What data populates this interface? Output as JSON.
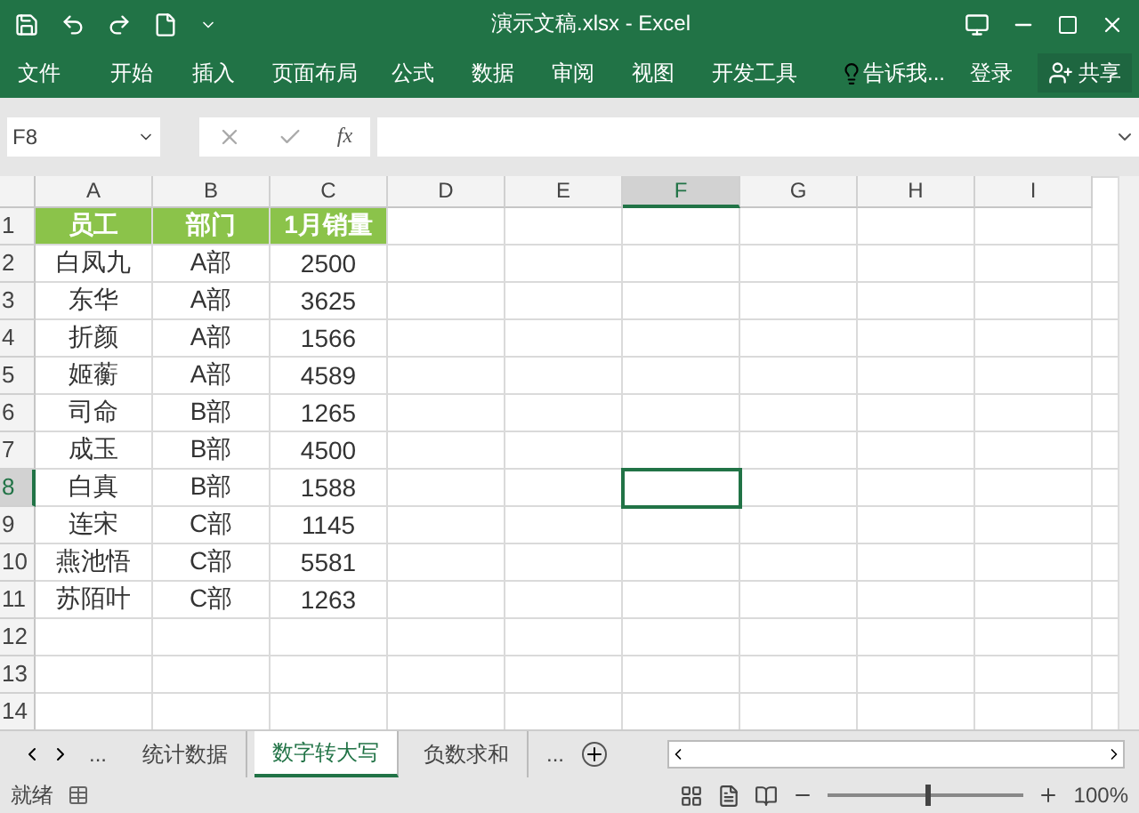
{
  "window": {
    "title": "演示文稿.xlsx - Excel"
  },
  "ribbon_tabs": [
    "文件",
    "开始",
    "插入",
    "页面布局",
    "公式",
    "数据",
    "审阅",
    "视图",
    "开发工具"
  ],
  "tell_me": "告诉我...",
  "sign_in": "登录",
  "share": "共享",
  "formula_bar": {
    "name_box": "F8",
    "fx": "fx"
  },
  "columns": [
    {
      "label": "A",
      "selected": false
    },
    {
      "label": "B",
      "selected": false
    },
    {
      "label": "C",
      "selected": false
    },
    {
      "label": "D",
      "selected": false
    },
    {
      "label": "E",
      "selected": false
    },
    {
      "label": "F",
      "selected": true
    },
    {
      "label": "G",
      "selected": false
    },
    {
      "label": "H",
      "selected": false
    },
    {
      "label": "I",
      "selected": false
    }
  ],
  "rows": [
    {
      "number": "1",
      "selected": false,
      "kind": "header",
      "cells": [
        "员工",
        "部门",
        "1月销量"
      ]
    },
    {
      "number": "2",
      "selected": false,
      "kind": "data",
      "cells": [
        "白凤九",
        "A部",
        "2500"
      ]
    },
    {
      "number": "3",
      "selected": false,
      "kind": "data",
      "cells": [
        "东华",
        "A部",
        "3625"
      ]
    },
    {
      "number": "4",
      "selected": false,
      "kind": "data",
      "cells": [
        "折颜",
        "A部",
        "1566"
      ]
    },
    {
      "number": "5",
      "selected": false,
      "kind": "data",
      "cells": [
        "姬蘅",
        "A部",
        "4589"
      ]
    },
    {
      "number": "6",
      "selected": false,
      "kind": "data",
      "cells": [
        "司命",
        "B部",
        "1265"
      ]
    },
    {
      "number": "7",
      "selected": false,
      "kind": "data",
      "cells": [
        "成玉",
        "B部",
        "4500"
      ]
    },
    {
      "number": "8",
      "selected": true,
      "kind": "data",
      "cells": [
        "白真",
        "B部",
        "1588"
      ]
    },
    {
      "number": "9",
      "selected": false,
      "kind": "data",
      "cells": [
        "连宋",
        "C部",
        "1145"
      ]
    },
    {
      "number": "10",
      "selected": false,
      "kind": "data",
      "cells": [
        "燕池悟",
        "C部",
        "5581"
      ]
    },
    {
      "number": "11",
      "selected": false,
      "kind": "data",
      "cells": [
        "苏陌叶",
        "C部",
        "1263"
      ]
    },
    {
      "number": "12",
      "selected": false
    },
    {
      "number": "13",
      "selected": false
    },
    {
      "number": "14",
      "selected": false
    }
  ],
  "sheet_tabs": [
    {
      "label": "统计数据",
      "selected": false
    },
    {
      "label": "数字转大写",
      "selected": true
    },
    {
      "label": "负数求和",
      "selected": false
    }
  ],
  "sheet_more_left": "...",
  "sheet_more_right": "...",
  "status_bar": {
    "status": "就绪",
    "zoom": {
      "level": 0.5,
      "reading": "100%"
    }
  }
}
